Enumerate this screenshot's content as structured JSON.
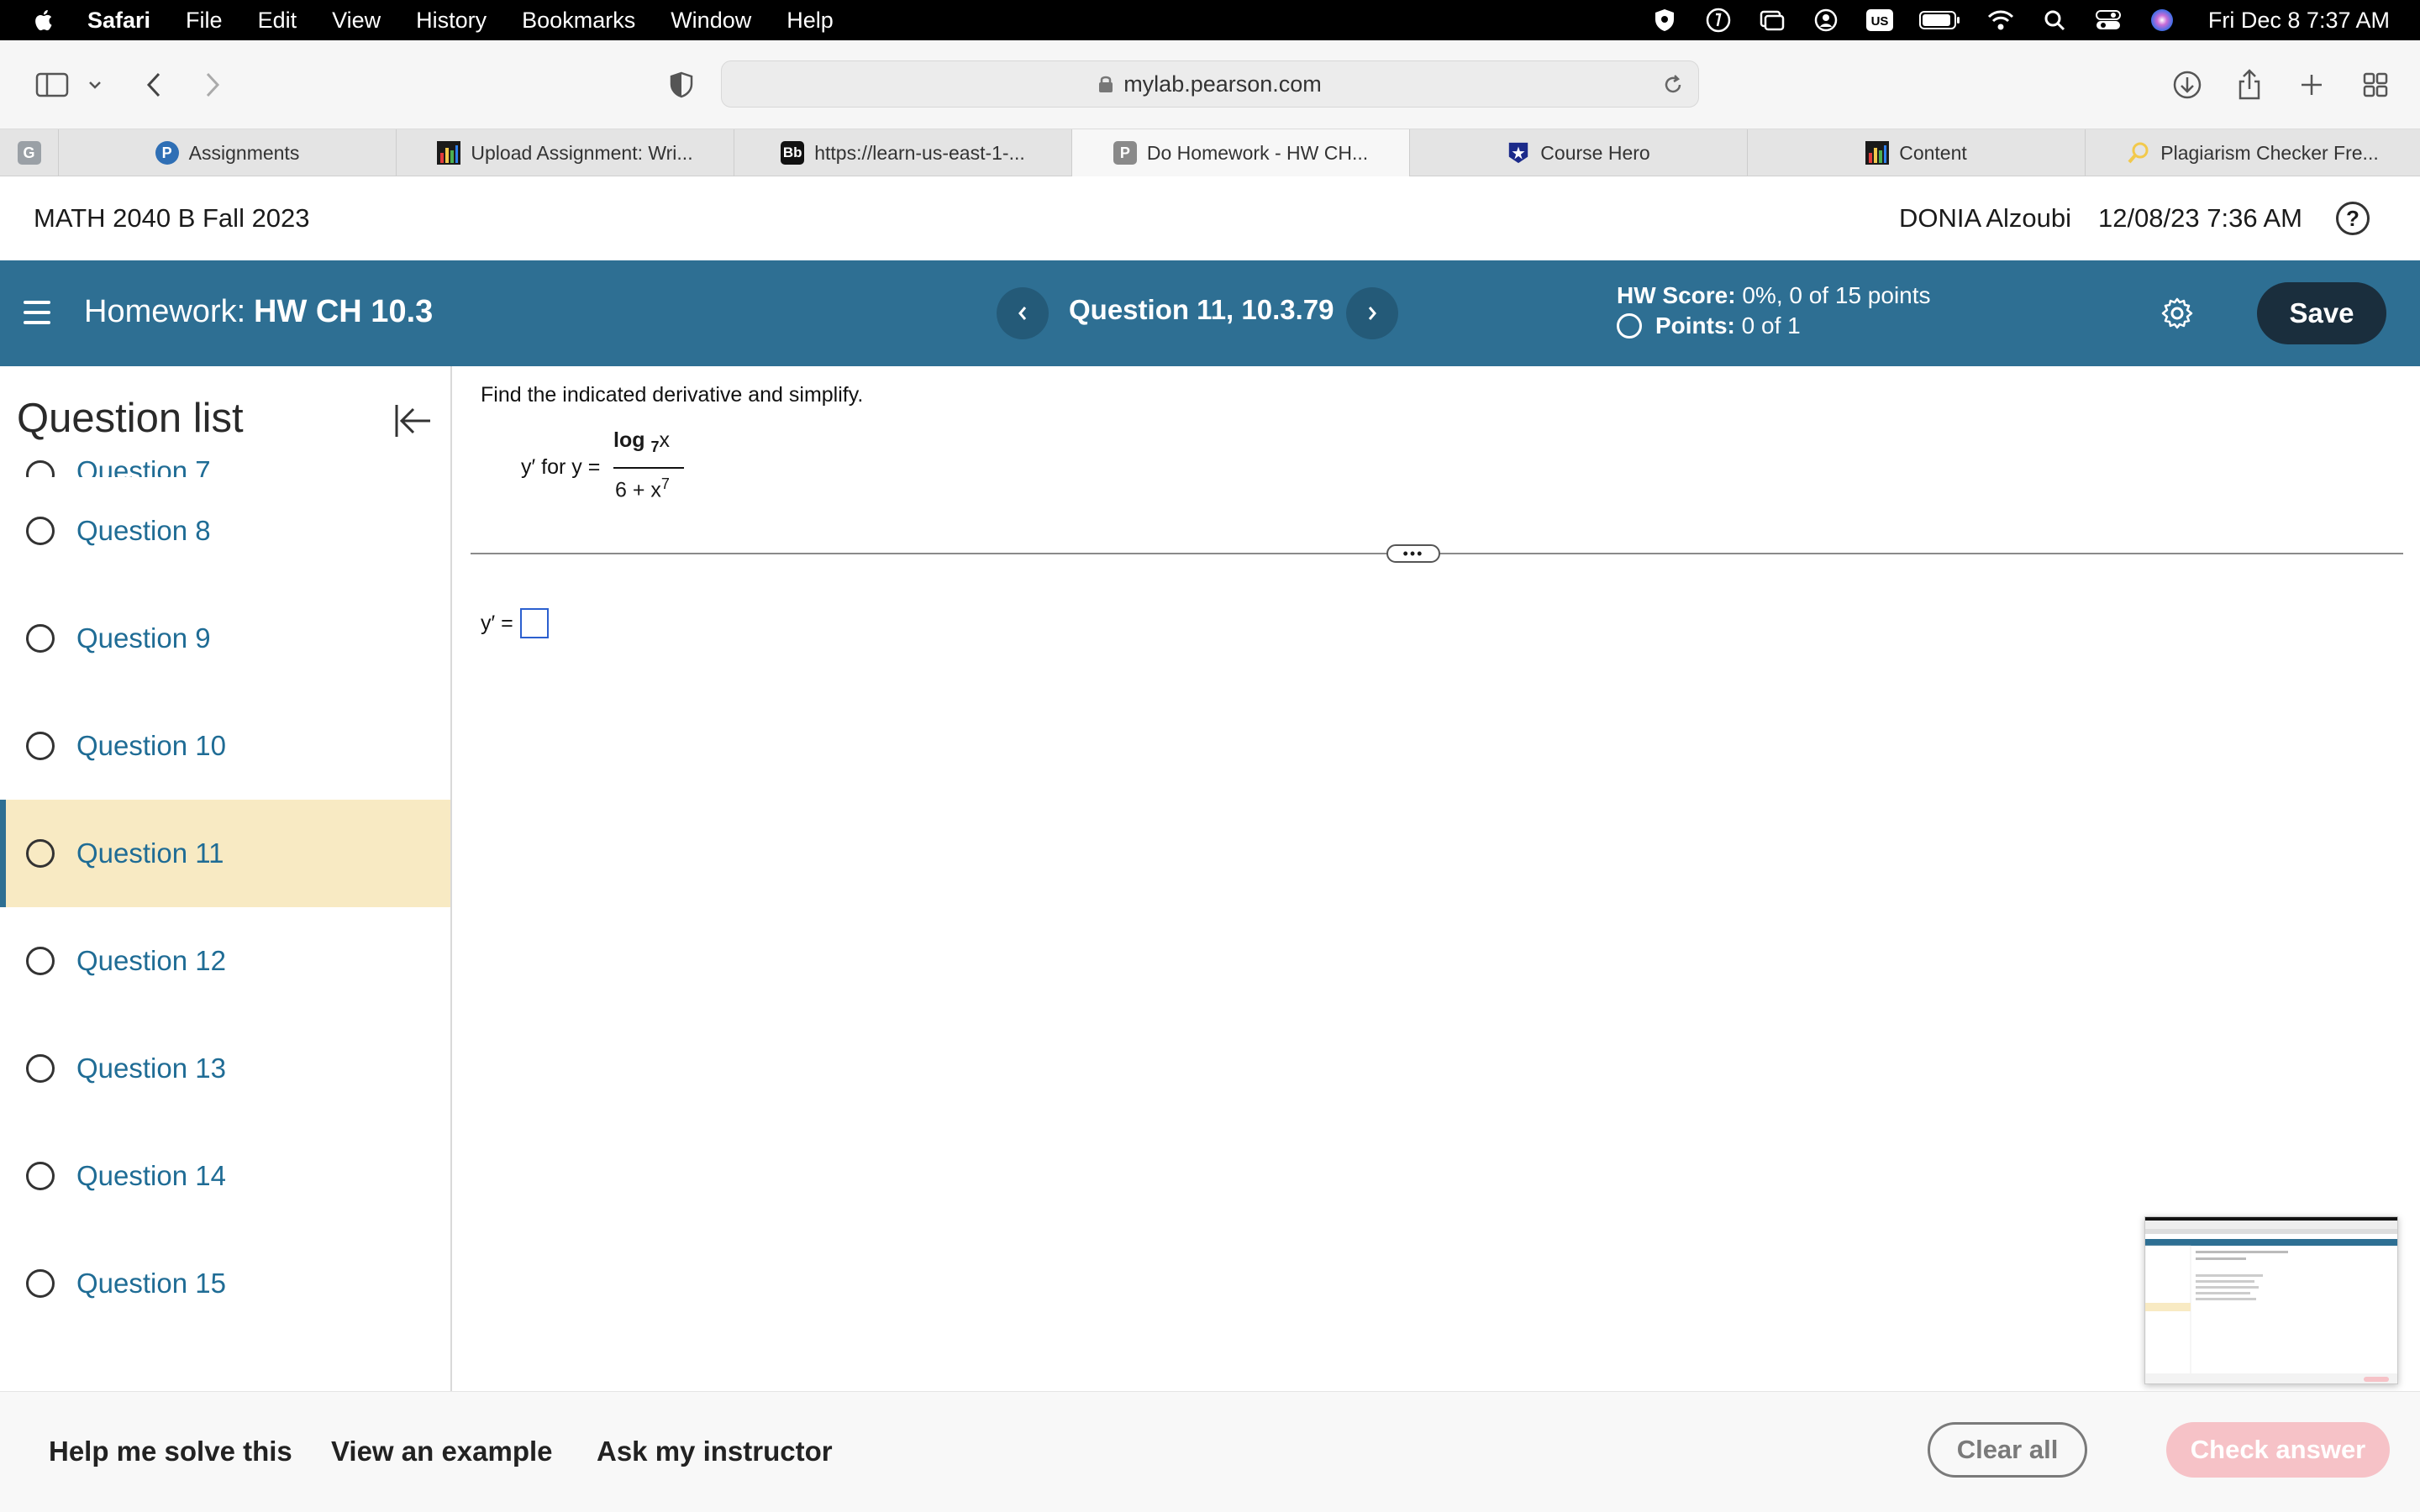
{
  "menubar": {
    "items": [
      "Safari",
      "File",
      "Edit",
      "View",
      "History",
      "Bookmarks",
      "Window",
      "Help"
    ],
    "clock": "Fri Dec 8  7:37 AM",
    "status_icons": [
      "vpn-shield-icon",
      "tunnel-icon",
      "screen-mirror-icon",
      "user-account-icon",
      "input-source-us-icon",
      "battery-icon",
      "wifi-icon",
      "spotlight-search-icon",
      "control-center-icon",
      "siri-icon"
    ],
    "input_source": "US"
  },
  "toolbar": {
    "url": "mylab.pearson.com"
  },
  "tabs": [
    {
      "label": "",
      "favicon": "G",
      "favicon_color": "#9aa0a6"
    },
    {
      "label": "Assignments",
      "favicon": "P",
      "favicon_color": "#2f6fb5"
    },
    {
      "label": "Upload Assignment: Wri...",
      "favicon": "bar-chart",
      "favicon_color": "#1a1a1a"
    },
    {
      "label": "https://learn-us-east-1-...",
      "favicon": "Bb",
      "favicon_color": "#111111"
    },
    {
      "label": "Do Homework - HW CH...",
      "favicon": "P",
      "favicon_color": "#8a8a8a"
    },
    {
      "label": "Course Hero",
      "favicon": "star",
      "favicon_color": "#1b2a8a"
    },
    {
      "label": "Content",
      "favicon": "bar-chart",
      "favicon_color": "#1a1a1a"
    },
    {
      "label": "Plagiarism Checker Fre...",
      "favicon": "magnifier",
      "favicon_color": "#f2c94c"
    }
  ],
  "course": {
    "title": "MATH 2040 B Fall 2023",
    "user": "DONIA Alzoubi",
    "datetime": "12/08/23 7:36 AM",
    "help": "?"
  },
  "hwbar": {
    "label": "Homework:",
    "name": "HW CH 10.3",
    "question_title": "Question 11, 10.3.79",
    "score_label": "HW Score:",
    "score_value": "0%, 0 of 15 points",
    "points_label": "Points:",
    "points_value": "0 of 1",
    "save": "Save"
  },
  "sidebar": {
    "heading": "Question list",
    "partial_item": "Question 7",
    "items": [
      "Question 8",
      "Question 9",
      "Question 10",
      "Question 11",
      "Question 12",
      "Question 13",
      "Question 14",
      "Question 15"
    ],
    "active": "Question 11"
  },
  "question": {
    "instruction": "Find the indicated derivative and simplify.",
    "prompt_prefix": "y′ for y =",
    "numerator_log": "log",
    "numerator_base": "7",
    "numerator_var": "x",
    "denominator_base": "6 + x",
    "denominator_exp": "7",
    "answer_label": "y′ ="
  },
  "footer": {
    "help_solve": "Help me solve this",
    "view_example": "View an example",
    "ask_instructor": "Ask my instructor",
    "clear_all": "Clear all",
    "check_answer": "Check answer"
  },
  "colors": {
    "brand_blue": "#2e6f93",
    "link_blue": "#1f6c95",
    "active_row": "#f8eac3",
    "save_button": "#1a2e3d",
    "check_disabled": "#f6c2c7"
  }
}
